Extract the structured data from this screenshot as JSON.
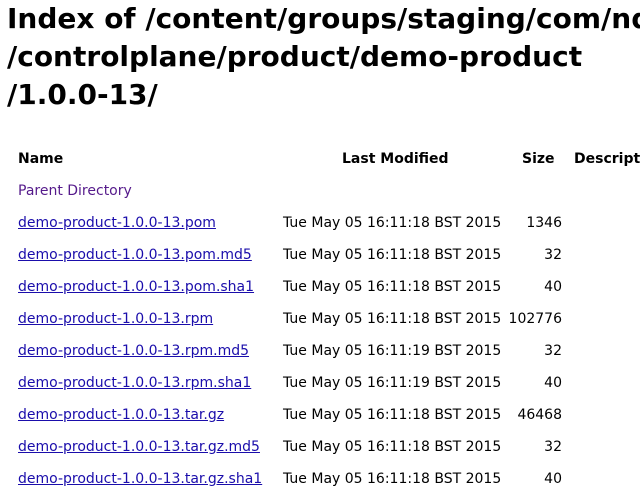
{
  "title_lines": [
    "Index of /content/groups/staging/com/nds",
    "/controlplane/product/demo-product",
    "/1.0.0-13/"
  ],
  "columns": {
    "name": "Name",
    "last_modified": "Last Modified",
    "size": "Size",
    "description": "Descripti"
  },
  "parent_link": "Parent Directory",
  "rows": [
    {
      "name": "demo-product-1.0.0-13.pom",
      "modified": "Tue May 05 16:11:18 BST 2015",
      "size": "1346"
    },
    {
      "name": "demo-product-1.0.0-13.pom.md5",
      "modified": "Tue May 05 16:11:18 BST 2015",
      "size": "32"
    },
    {
      "name": "demo-product-1.0.0-13.pom.sha1",
      "modified": "Tue May 05 16:11:18 BST 2015",
      "size": "40"
    },
    {
      "name": "demo-product-1.0.0-13.rpm",
      "modified": "Tue May 05 16:11:18 BST 2015",
      "size": "102776"
    },
    {
      "name": "demo-product-1.0.0-13.rpm.md5",
      "modified": "Tue May 05 16:11:19 BST 2015",
      "size": "32"
    },
    {
      "name": "demo-product-1.0.0-13.rpm.sha1",
      "modified": "Tue May 05 16:11:19 BST 2015",
      "size": "40"
    },
    {
      "name": "demo-product-1.0.0-13.tar.gz",
      "modified": "Tue May 05 16:11:18 BST 2015",
      "size": "46468"
    },
    {
      "name": "demo-product-1.0.0-13.tar.gz.md5",
      "modified": "Tue May 05 16:11:18 BST 2015",
      "size": "32"
    },
    {
      "name": "demo-product-1.0.0-13.tar.gz.sha1",
      "modified": "Tue May 05 16:11:18 BST 2015",
      "size": "40"
    }
  ]
}
